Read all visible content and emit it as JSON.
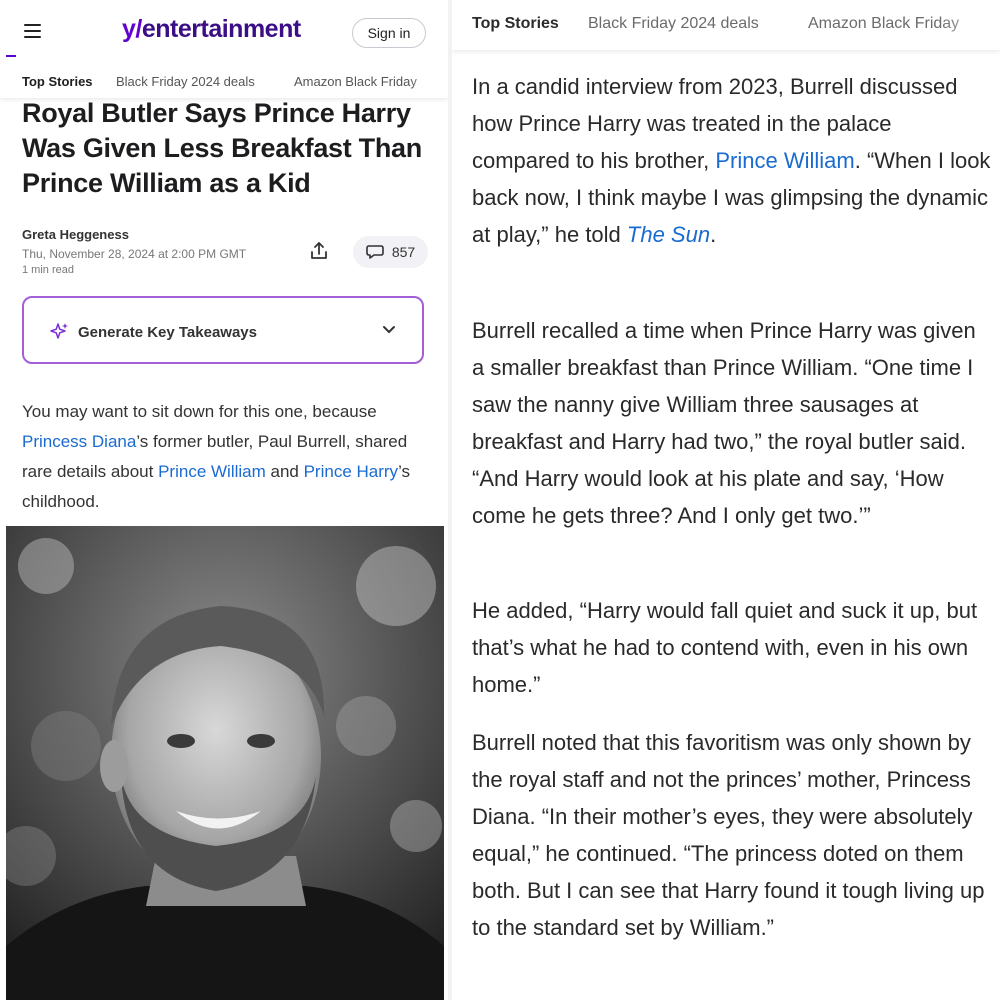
{
  "left": {
    "brand": {
      "y_mark": "y/",
      "name": "entertainment"
    },
    "signin_label": "Sign in",
    "tabs": [
      "Top Stories",
      "Black Friday 2024 deals",
      "Amazon Black Friday"
    ],
    "article": {
      "headline": "Royal Butler Says Prince Harry Was Given Less Breakfast Than Prince William as a Kid",
      "author": "Greta Heggeness",
      "date": "Thu, November 28, 2024 at 2:00 PM GMT",
      "read_time": "1 min read",
      "comment_count": "857",
      "takeaways_label": "Generate Key Takeaways",
      "intro": {
        "p1": "You may want to sit down for this one, because ",
        "link1": "Princess Diana",
        "p2": "’s former butler, Paul Burrell, shared rare details about ",
        "link2": "Prince William",
        "p3": " and ",
        "link3": "Prince Harry",
        "p4": "’s childhood."
      }
    }
  },
  "right": {
    "tabs": [
      "Top Stories",
      "Black Friday 2024 deals",
      "Amazon Black Friday"
    ],
    "p1": {
      "a": "In a candid interview from 2023, Burrell discussed how Prince Harry was treated in the palace compared to his brother, ",
      "link": "Prince William",
      "b": ". “When I look back now, I think maybe I was glimpsing the dynamic at play,” he told ",
      "source": "The Sun",
      "c": "."
    },
    "p2": "Burrell recalled a time when Prince Harry was given a smaller breakfast than Prince William. “One time I saw the nanny give William three sausages at breakfast and Harry had two,” the royal butler said. “And Harry would look at his plate and say, ‘How come he gets three? And I only get two.’”",
    "p3": "He added, “Harry would fall quiet and suck it up, but that’s what he had to contend with, even in his own home.”",
    "p4": "Burrell noted that this favoritism was only shown by the royal staff and not the princes’ mother, Princess Diana. “In their mother’s eyes, they were absolutely equal,” he continued. “The princess doted on them both. But I can see that Harry found it tough living up to the standard set by William.”"
  },
  "colors": {
    "brand": "#6001d2",
    "link": "#1a6bd0",
    "takeaways_border": "#a55fd6"
  },
  "icons": [
    "menu-icon",
    "share-icon",
    "comment-icon",
    "sparkle-icon",
    "chevron-down-icon"
  ]
}
